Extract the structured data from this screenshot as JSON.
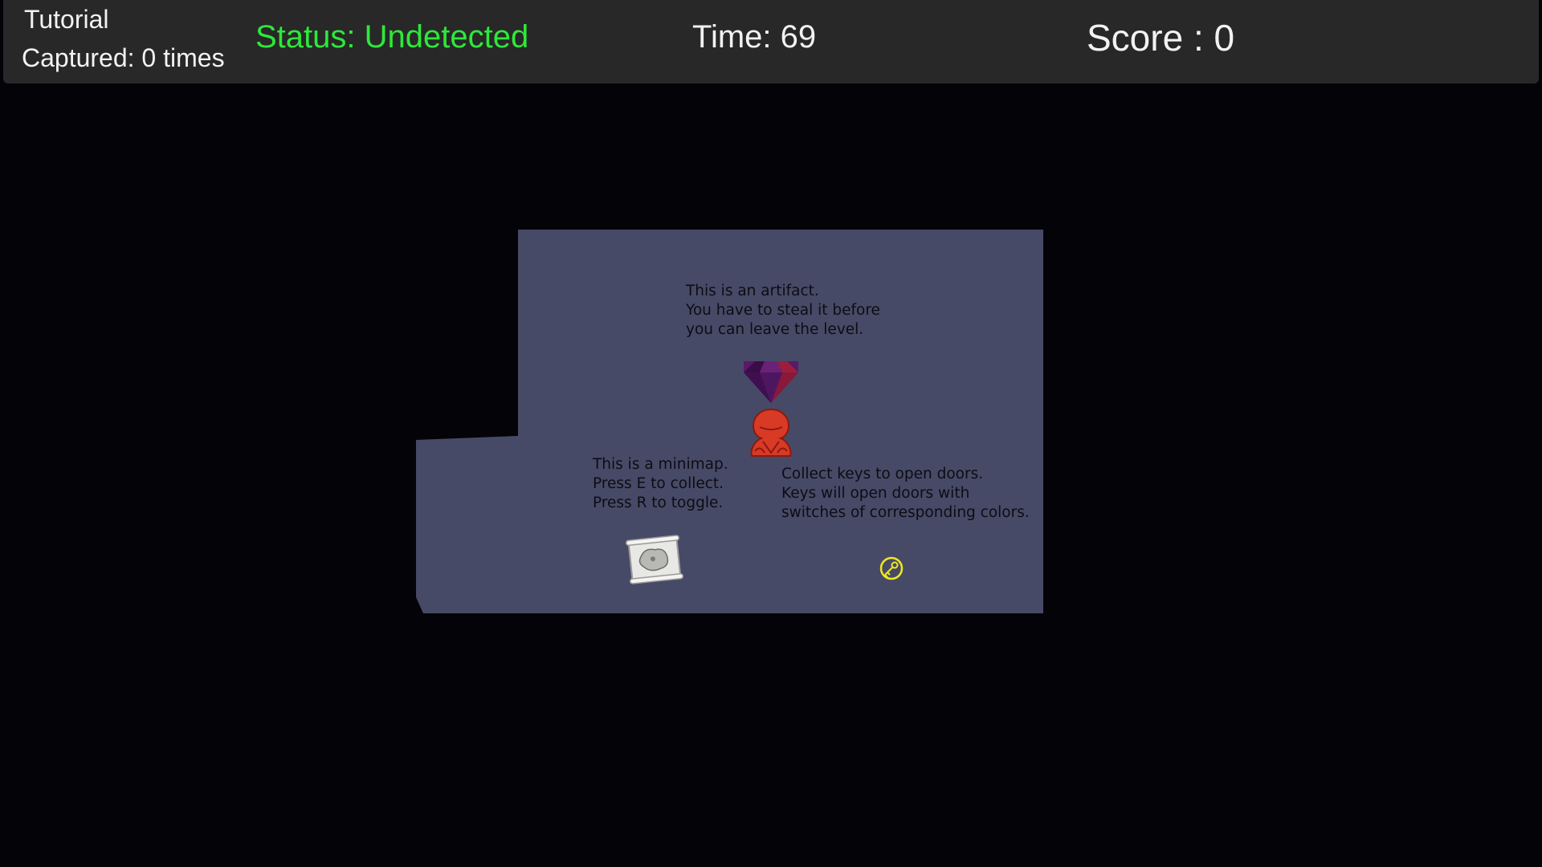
{
  "hud": {
    "level_name": "Tutorial",
    "captured": "Captured: 0 times",
    "status": "Status: Undetected",
    "time": "Time: 69",
    "score": "Score : 0"
  },
  "colors": {
    "hud_background": "#282828",
    "hud_text": "#f2f2f2",
    "status_undetected": "#2ee83a",
    "floor": "#474a66",
    "void": "#040408",
    "player": "#d83a26",
    "artifact": "#4a1456",
    "key": "#f0e81e"
  },
  "tutorial": {
    "artifact_text": "This is an artifact.\nYou have to steal it before\nyou can leave the level.",
    "minimap_text": "This is a minimap.\nPress E to collect.\nPress R to toggle.",
    "keys_text": "Collect keys to open doors.\nKeys will open doors with\nswitches of corresponding colors."
  },
  "sprites": {
    "artifact": "gem-icon",
    "player": "hooded-thief-icon",
    "minimap": "map-scroll-icon",
    "key": "key-icon"
  }
}
